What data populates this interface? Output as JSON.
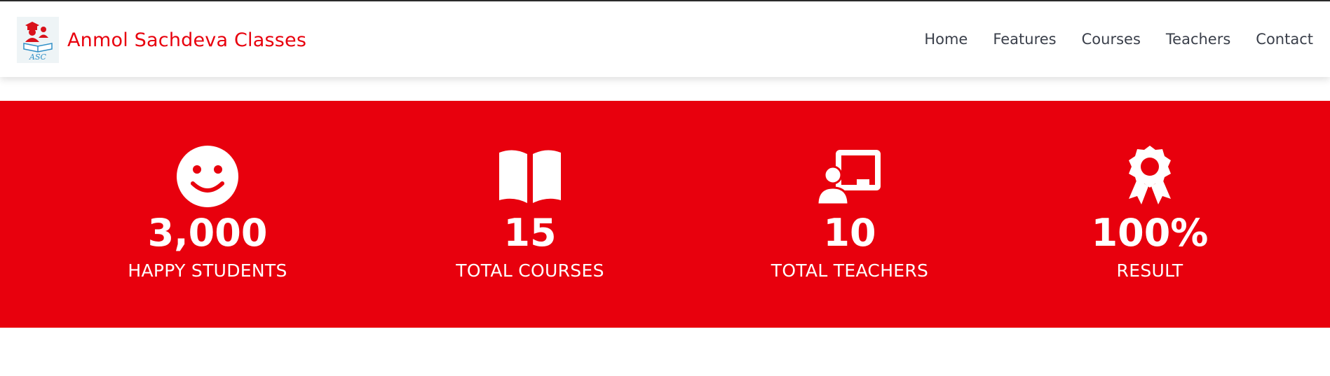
{
  "brand": {
    "name": "Anmol Sachdeva Classes",
    "logo_text": "ASC"
  },
  "nav": {
    "items": [
      {
        "label": "Home"
      },
      {
        "label": "Features"
      },
      {
        "label": "Courses"
      },
      {
        "label": "Teachers"
      },
      {
        "label": "Contact"
      }
    ]
  },
  "stats": [
    {
      "icon": "smile-icon",
      "value": "3,000",
      "label": "HAPPY STUDENTS"
    },
    {
      "icon": "book-open-icon",
      "value": "15",
      "label": "TOTAL COURSES"
    },
    {
      "icon": "chalkboard-teacher-icon",
      "value": "10",
      "label": "TOTAL TEACHERS"
    },
    {
      "icon": "award-icon",
      "value": "100%",
      "label": "RESULT"
    }
  ],
  "colors": {
    "accent": "#e8000d",
    "nav_text": "#3a3f4a",
    "stat_text": "#ffffff"
  }
}
